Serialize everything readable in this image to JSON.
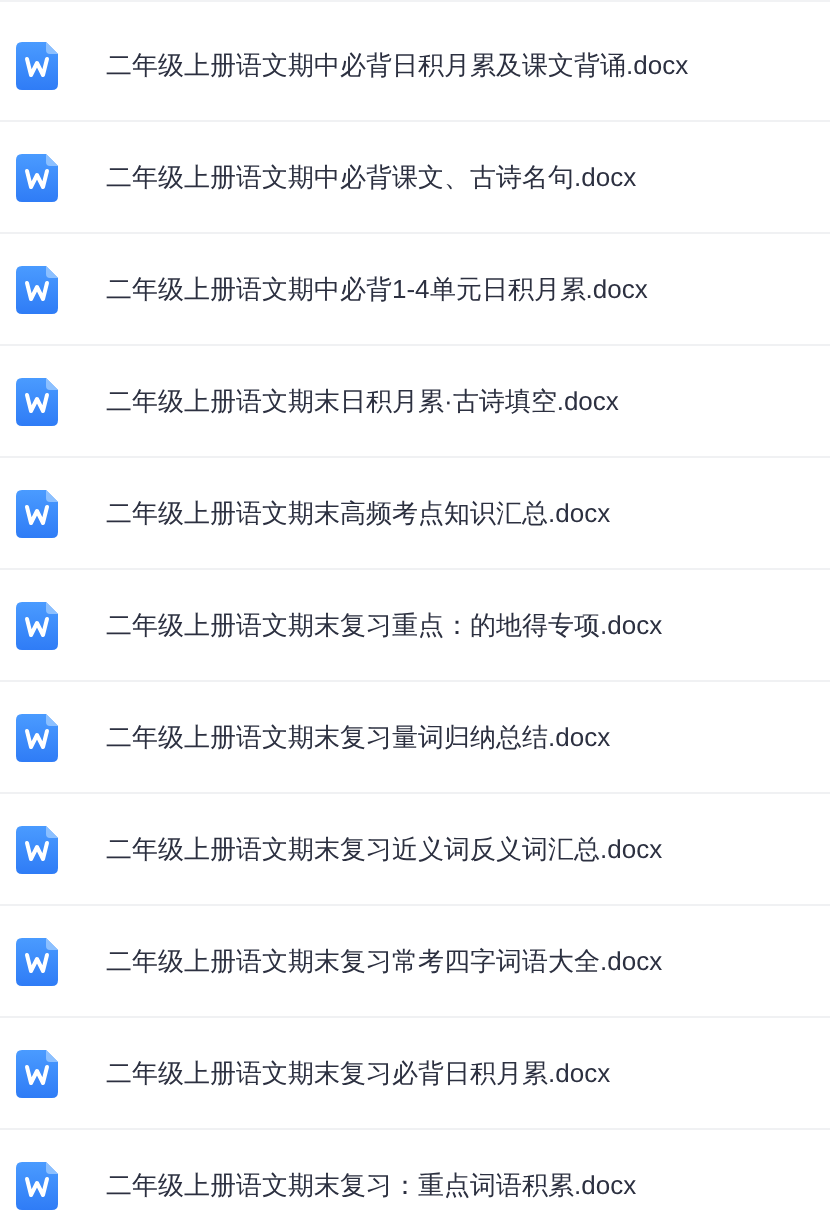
{
  "files": [
    {
      "name": "二年级上册语文期中必背日积月累及课文背诵.docx"
    },
    {
      "name": "二年级上册语文期中必背课文、古诗名句.docx"
    },
    {
      "name": "二年级上册语文期中必背1-4单元日积月累.docx"
    },
    {
      "name": "二年级上册语文期末日积月累·古诗填空.docx"
    },
    {
      "name": "二年级上册语文期末高频考点知识汇总.docx"
    },
    {
      "name": "二年级上册语文期末复习重点：的地得专项.docx"
    },
    {
      "name": "二年级上册语文期末复习量词归纳总结.docx"
    },
    {
      "name": "二年级上册语文期末复习近义词反义词汇总.docx"
    },
    {
      "name": "二年级上册语文期末复习常考四字词语大全.docx"
    },
    {
      "name": "二年级上册语文期末复习必背日积月累.docx"
    },
    {
      "name": "二年级上册语文期末复习：重点词语积累.docx"
    }
  ]
}
